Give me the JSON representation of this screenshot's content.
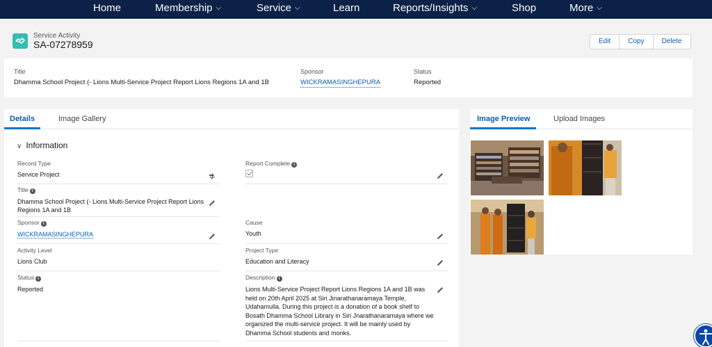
{
  "nav": {
    "items": [
      {
        "label": "Home",
        "dropdown": false
      },
      {
        "label": "Membership",
        "dropdown": true
      },
      {
        "label": "Service",
        "dropdown": true
      },
      {
        "label": "Learn",
        "dropdown": false
      },
      {
        "label": "Reports/Insights",
        "dropdown": true
      },
      {
        "label": "Shop",
        "dropdown": false
      },
      {
        "label": "More",
        "dropdown": true
      }
    ],
    "background": "#0b2147"
  },
  "header": {
    "object_type": "Service Activity",
    "record_id": "SA-07278959",
    "icon": "handshake-icon",
    "actions": [
      "Edit",
      "Copy",
      "Delete"
    ]
  },
  "highlights": {
    "title_label": "Title",
    "title_value": "Dhamma School Project (- Lions Multi-Service Project Report Lions Regions 1A and 1B",
    "sponsor_label": "Sponsor",
    "sponsor_value": "WICKRAMASINGHEPURA",
    "status_label": "Status",
    "status_value": "Reported"
  },
  "detail_tabs": [
    "Details",
    "Image Gallery"
  ],
  "section_title": "Information",
  "fields": {
    "record_type": {
      "label": "Record Type",
      "value": "Service Project"
    },
    "report_complete": {
      "label": "Report Complete",
      "checked": true
    },
    "title": {
      "label": "Title",
      "value": "Dhamma School Project (- Lions Multi-Service Project Report Lions Regions 1A and 1B"
    },
    "sponsor": {
      "label": "Sponsor",
      "value": "WICKRAMASINGHEPURA"
    },
    "cause": {
      "label": "Cause",
      "value": "Youth"
    },
    "activity_level": {
      "label": "Activity Level",
      "value": "Lions Club"
    },
    "project_type": {
      "label": "Project Type",
      "value": "Education and Literacy"
    },
    "status": {
      "label": "Status",
      "value": "Reported"
    },
    "description": {
      "label": "Description",
      "value": "Lions Multi-Service Project Report Lions Regions 1A and 1B was held on 20th April 2025 at Siri Jinarathanaramaya Temple, Udahamulla. During this project is a donation of a book shelf to Bosath Dhamma School Library in Siri Jnarathanaramaya where we organized the multi-service project. It will be mainly used by Dhamma School students and monks."
    }
  },
  "image_tabs": [
    "Image Preview",
    "Upload Images"
  ],
  "colors": {
    "accent": "#0176d3",
    "link": "#0b5cab",
    "icon_bg": "#34bdb0"
  }
}
